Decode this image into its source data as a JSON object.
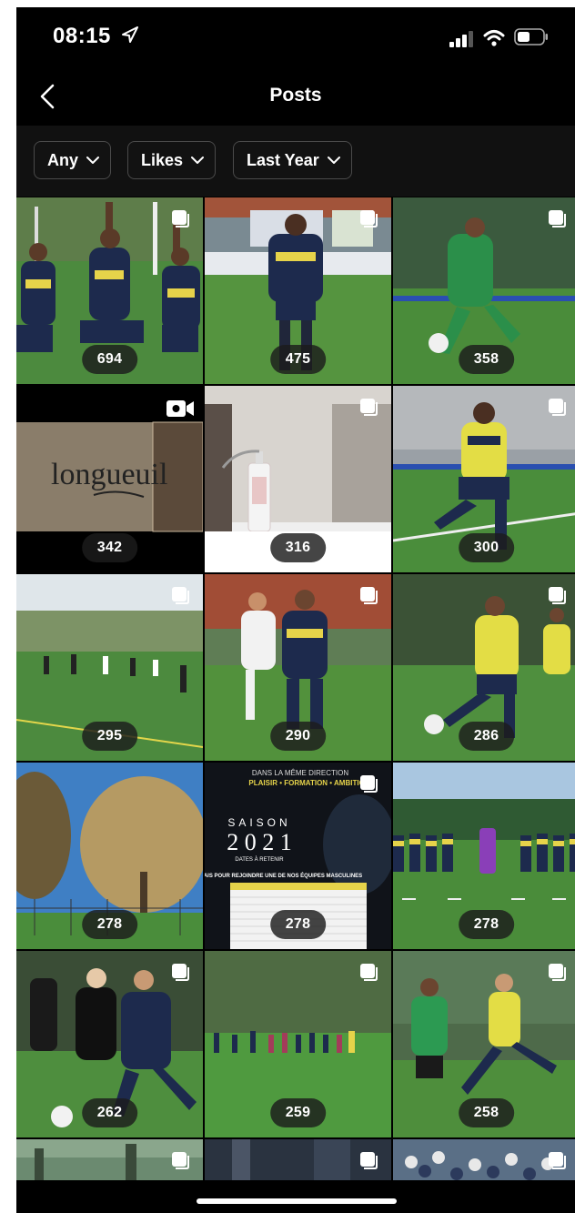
{
  "status_bar": {
    "time": "08:15",
    "location_icon": "location-arrow-icon",
    "signal_icon": "cellular-signal-icon",
    "wifi_icon": "wifi-icon",
    "battery_icon": "battery-icon"
  },
  "nav": {
    "back_icon": "chevron-left-icon",
    "title": "Posts"
  },
  "filters": [
    {
      "label": "Any",
      "icon": "chevron-down-icon"
    },
    {
      "label": "Likes",
      "icon": "chevron-down-icon"
    },
    {
      "label": "Last Year",
      "icon": "chevron-down-icon"
    }
  ],
  "posts": [
    {
      "likes": "694",
      "type": "carousel",
      "scene": "team kneeling with raised fists"
    },
    {
      "likes": "475",
      "type": "carousel",
      "scene": "player standing on pitch"
    },
    {
      "likes": "358",
      "type": "carousel",
      "scene": "goalkeeper kicking ball"
    },
    {
      "likes": "342",
      "type": "video",
      "scene": "Longueuil sign"
    },
    {
      "likes": "316",
      "type": "carousel",
      "scene": "hand sanitizer bottle"
    },
    {
      "likes": "300",
      "type": "carousel",
      "scene": "player dribbling"
    },
    {
      "likes": "295",
      "type": "carousel",
      "scene": "training on field"
    },
    {
      "likes": "290",
      "type": "carousel",
      "scene": "two players chasing"
    },
    {
      "likes": "286",
      "type": "carousel",
      "scene": "player striking ball"
    },
    {
      "likes": "278",
      "type": "none",
      "scene": "autumn trees"
    },
    {
      "likes": "278",
      "type": "carousel",
      "scene": "saison 2021 poster"
    },
    {
      "likes": "278",
      "type": "none",
      "scene": "team lineup"
    },
    {
      "likes": "262",
      "type": "carousel",
      "scene": "women match"
    },
    {
      "likes": "259",
      "type": "carousel",
      "scene": "wide shot of game"
    },
    {
      "likes": "258",
      "type": "carousel",
      "scene": "players running"
    },
    {
      "likes": "",
      "type": "carousel",
      "scene": "partial row"
    },
    {
      "likes": "",
      "type": "carousel",
      "scene": "partial row"
    },
    {
      "likes": "",
      "type": "carousel",
      "scene": "partial row"
    }
  ],
  "poster_text": {
    "line1": "DANS LA MÊME DIRECTION",
    "line2": "PLAISIR • FORMATION • AMBITION",
    "season": "SAISON",
    "year": "2 0 2 1",
    "subtitle": "DATES À RETENIR",
    "headline": "ESSAIS POUR REJOINDRE UNE DE NOS ÉQUIPES MASCULINES"
  },
  "sign_text": "longueuil",
  "colors": {
    "background": "#000000",
    "text": "#ffffff",
    "chip_border": "#4a4a4a",
    "badge_bg": "#1c1c1c",
    "jersey_yellow": "#d8d23a",
    "jersey_navy": "#1c2847",
    "grass": "#3f7d37"
  }
}
